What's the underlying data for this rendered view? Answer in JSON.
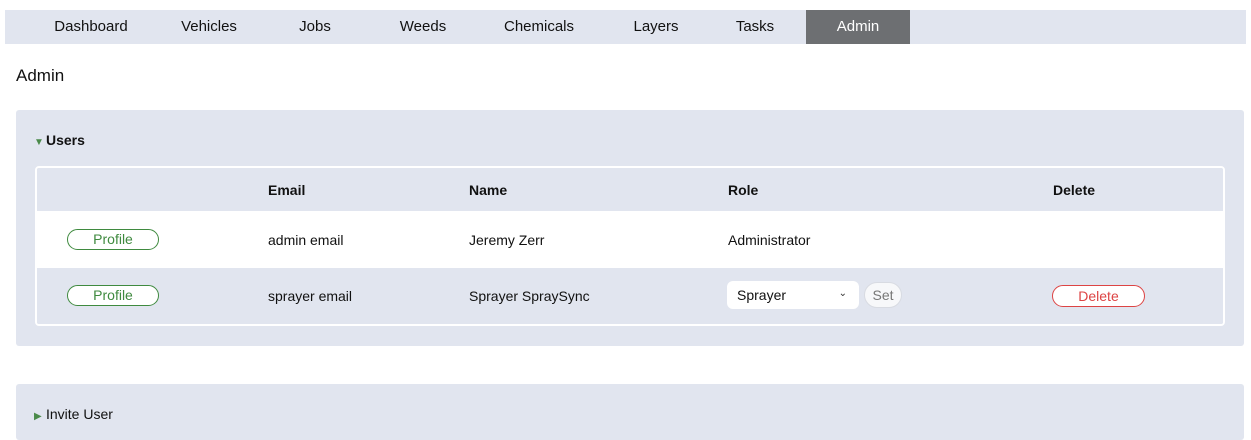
{
  "nav": {
    "items": [
      {
        "label": "Dashboard"
      },
      {
        "label": "Vehicles"
      },
      {
        "label": "Jobs"
      },
      {
        "label": "Weeds"
      },
      {
        "label": "Chemicals"
      },
      {
        "label": "Layers"
      },
      {
        "label": "Tasks"
      },
      {
        "label": "Admin",
        "active": true
      }
    ]
  },
  "page": {
    "title": "Admin"
  },
  "users": {
    "summary": "Users",
    "columns": {
      "email": "Email",
      "name": "Name",
      "role": "Role",
      "delete": "Delete"
    },
    "rows": [
      {
        "profile": "Profile",
        "email": "admin email",
        "name": "Jeremy Zerr",
        "role": "Administrator"
      },
      {
        "profile": "Profile",
        "email": "sprayer email",
        "name": "Sprayer SpraySync",
        "role": "Sprayer",
        "set": "Set",
        "delete": "Delete"
      }
    ]
  },
  "invite": {
    "summary": "Invite User"
  },
  "colors": {
    "accent_green": "#3f8a3f",
    "danger_red": "#dd4444",
    "panel_bg": "#e1e5ef",
    "active_tab": "#6d6f72"
  }
}
